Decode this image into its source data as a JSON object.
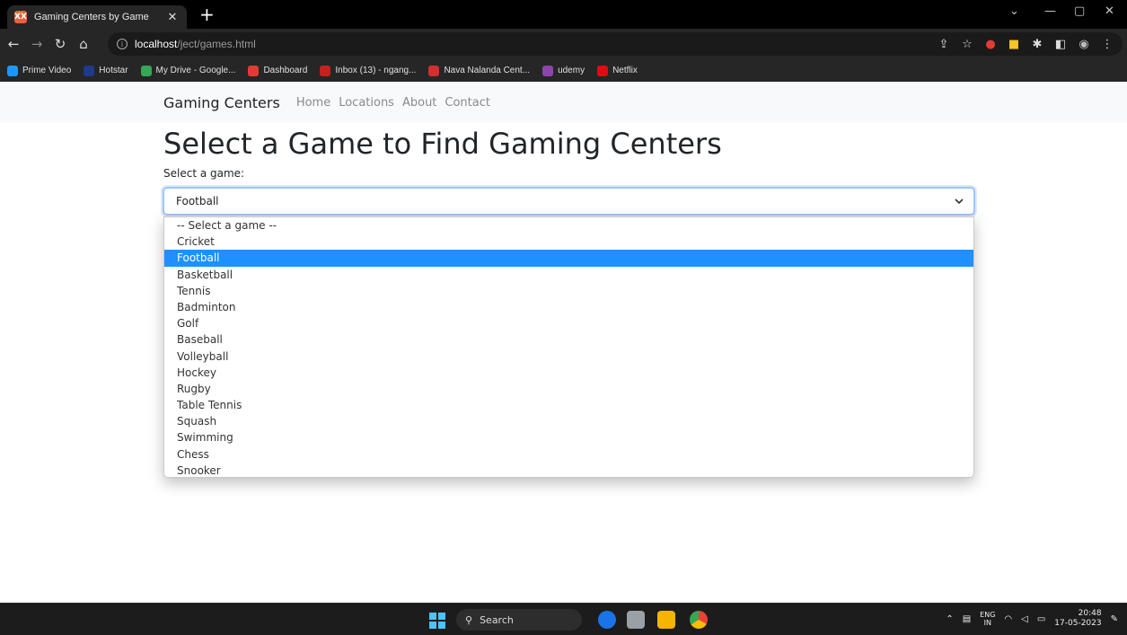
{
  "browser": {
    "tab_title": "Gaming Centers by Game",
    "tab_favicon_text": "XX",
    "new_tab": "+",
    "url_host": "localhost",
    "url_path": "/ject/games.html",
    "bookmarks": [
      {
        "label": "Prime Video",
        "color": "#1a98ff"
      },
      {
        "label": "Hotstar",
        "color": "#1f3a8a"
      },
      {
        "label": "My Drive - Google...",
        "color": "#34a853"
      },
      {
        "label": "Dashboard",
        "color": "#e53935"
      },
      {
        "label": "Inbox (13) - ngang...",
        "color": "#c5221f"
      },
      {
        "label": "Nava Nalanda Cent...",
        "color": "#d32f2f"
      },
      {
        "label": "udemy",
        "color": "#8e44ad"
      },
      {
        "label": "Netflix",
        "color": "#e50914"
      }
    ]
  },
  "navbar": {
    "brand": "Gaming Centers",
    "links": [
      "Home",
      "Locations",
      "About",
      "Contact"
    ]
  },
  "main": {
    "heading": "Select a Game to Find Gaming Centers",
    "select_label": "Select a game:",
    "selected_value": "Football",
    "options": [
      "-- Select a game --",
      "Cricket",
      "Football",
      "Basketball",
      "Tennis",
      "Badminton",
      "Golf",
      "Baseball",
      "Volleyball",
      "Hockey",
      "Rugby",
      "Table Tennis",
      "Squash",
      "Swimming",
      "Chess",
      "Snooker"
    ],
    "selected_index": 2,
    "highlight_color": "#1e90ff"
  },
  "taskbar": {
    "search_label": "Search",
    "lang_top": "ENG",
    "lang_bottom": "IN",
    "time": "20:48",
    "date": "17-05-2023"
  }
}
